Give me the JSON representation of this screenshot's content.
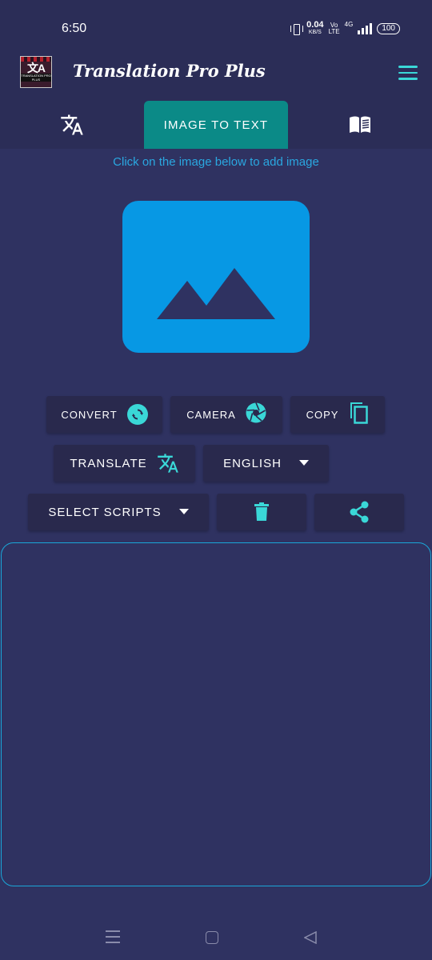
{
  "status_bar": {
    "time": "6:50",
    "net_speed_value": "0.04",
    "net_speed_unit": "KB/S",
    "volte_top": "Vo",
    "volte_bottom": "LTE",
    "network": "4G",
    "battery": "100"
  },
  "header": {
    "app_title": "Translation Pro Plus",
    "logo_glyph": "文A",
    "logo_caption": "TRANSLATION PRO PLUS",
    "menu_icon": "hamburger-icon"
  },
  "tabs": [
    {
      "label": "",
      "icon": "translate-icon",
      "active": false
    },
    {
      "label": "IMAGE TO TEXT",
      "icon": "",
      "active": true
    },
    {
      "label": "",
      "icon": "book-icon",
      "active": false
    }
  ],
  "main": {
    "hint": "Click on the image below to add image",
    "image_picker_icon": "image-placeholder-icon"
  },
  "buttons": {
    "convert": "CONVERT",
    "camera": "CAMERA",
    "copy": "COPY",
    "translate": "TRANSLATE",
    "language": "ENGLISH",
    "select_scripts": "SELECT SCRIPTS"
  },
  "text_area": {
    "value": ""
  },
  "colors": {
    "background": "#2f3261",
    "header": "#2b2d57",
    "accent": "#3ad7d7",
    "active_tab": "#0b8a87",
    "image_blue": "#0798e4",
    "hint_blue": "#2aa7e0",
    "button_bg": "#29294d"
  }
}
